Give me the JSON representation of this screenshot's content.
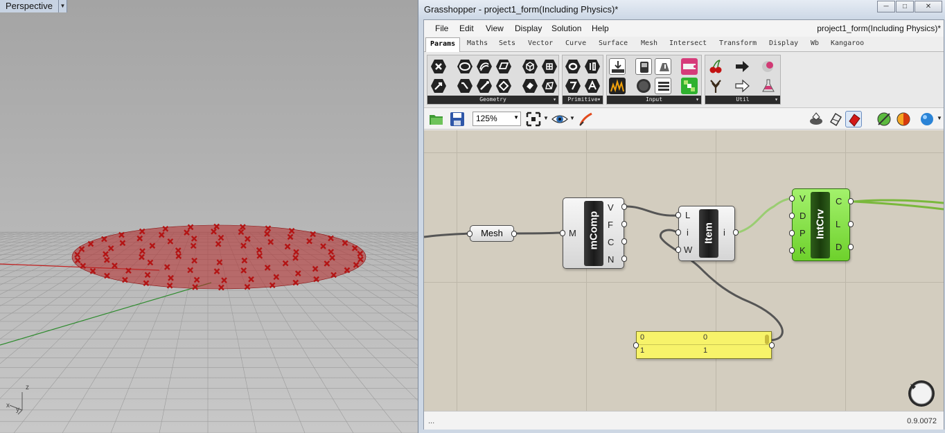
{
  "viewport": {
    "title": "Perspective",
    "axis_labels": {
      "z": "z",
      "x": "x",
      "y": "y"
    },
    "point_color": "#b31414",
    "disk_color": "#b52828"
  },
  "grasshopper": {
    "window_title": "Grasshopper - project1_form(Including Physics)*",
    "window_buttons": {
      "minimize": "─",
      "maximize": "□",
      "close": "✕"
    },
    "menu": [
      "File",
      "Edit",
      "View",
      "Display",
      "Solution",
      "Help"
    ],
    "document_name": "project1_form(Including Physics)*",
    "tabs": [
      "Params",
      "Maths",
      "Sets",
      "Vector",
      "Curve",
      "Surface",
      "Mesh",
      "Intersect",
      "Transform",
      "Display",
      "Wb",
      "Kangaroo"
    ],
    "active_tab": "Params",
    "panels": [
      "Geometry",
      "Primitive",
      "Input",
      "Util"
    ],
    "zoom": "125%",
    "components": {
      "mesh_param": "Mesh",
      "mcomp": {
        "name": "mComp",
        "inputs": [
          "M"
        ],
        "outputs": [
          "V",
          "F",
          "C",
          "N"
        ]
      },
      "item": {
        "name": "Item",
        "inputs": [
          "L",
          "i",
          "W"
        ],
        "outputs": [
          "i"
        ]
      },
      "intcrv": {
        "name": "IntCrv",
        "inputs": [
          "V",
          "D",
          "P",
          "K"
        ],
        "outputs": [
          "C",
          "L",
          "D"
        ],
        "color": "#7ee23a"
      }
    },
    "panel_yellow": {
      "rows": [
        {
          "index": "0",
          "value": "0"
        },
        {
          "index": "1",
          "value": "1"
        }
      ],
      "color": "#f7f36a"
    },
    "status_left": "...",
    "version": "0.9.0072"
  }
}
